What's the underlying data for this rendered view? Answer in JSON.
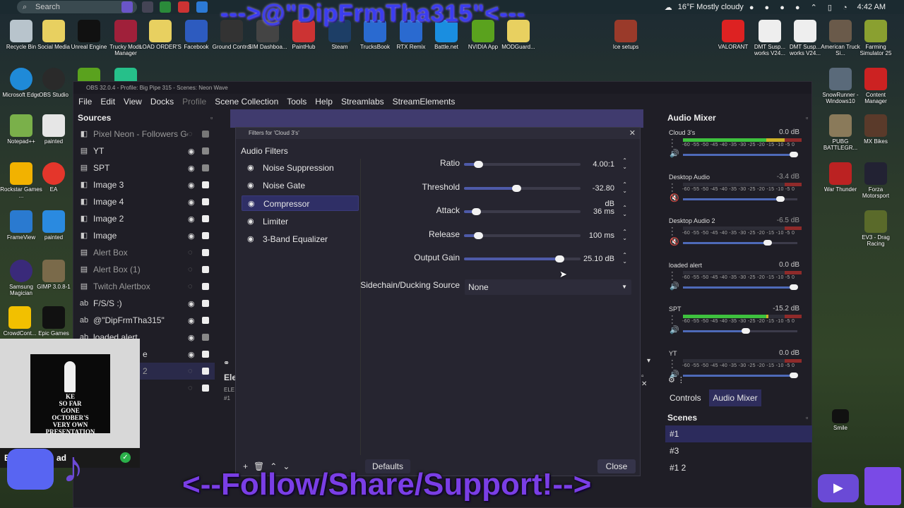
{
  "taskbar": {
    "search_placeholder": "Search",
    "weather": "16°F  Mostly cloudy",
    "time": "4:42 AM"
  },
  "banner_top": "--->@\"DipFrmTha315\"<---",
  "banner_bottom": "<--Follow/Share/Support!-->",
  "desktop_icons": {
    "recycle": "Recycle Bin",
    "social": "Social Media",
    "unreal": "Unreal Engine",
    "trucky": "Trucky Mods Manager",
    "load": "LOAD ORDER'S",
    "facebook": "Facebook",
    "ground": "Ground Control",
    "sim": "SIM Dashboa...",
    "painthub": "PaintHub",
    "steam": "Steam",
    "trucksbook": "TrucksBook",
    "rtx": "RTX Remix",
    "battle": "Battle.net",
    "nvidia": "NVIDIA App",
    "modguard": "MODGuard...",
    "ice": "Ice setups",
    "valorant": "VALORANT",
    "dmt1": "DMT Susp... works V24...",
    "dmt2": "DMT Susp... works V24...",
    "ats": "American Truck Si...",
    "farming": "Farming Simulator 25",
    "edge": "Microsoft Edge",
    "obs": "OBS Studio",
    "snowrunner": "SnowRunner - Windows10",
    "content": "Content Manager",
    "notepad": "Notepad++",
    "painted1": "painted",
    "pubg": "PUBG BATTLEGR...",
    "mxbikes": "MX Bikes",
    "rockstar": "Rockstar Games ...",
    "ea": "EA",
    "warthunder": "War Thunder",
    "forza": "Forza Motorsport",
    "frameview": "FrameView",
    "painted2": "painted",
    "ev3": "EV3 - Drag Racing",
    "samsung": "Samsung Magician",
    "gimp": "GIMP 3.0.8-1",
    "crowd": "CrowdCont...",
    "epic": "Epic Games",
    "smile": "Smile"
  },
  "obs": {
    "title": "OBS 32.0.4 - Profile: Big Pipe 315 - Scenes: Neon Wave",
    "menu": [
      "File",
      "Edit",
      "View",
      "Docks",
      "Profile",
      "Scene Collection",
      "Tools",
      "Help",
      "Streamlabs",
      "StreamElements"
    ],
    "sources_title": "Sources",
    "sources": [
      "Pixel Neon - Followers Goal",
      "YT",
      "SPT",
      "Image 3",
      "Image 4",
      "Image 2",
      "Image",
      "Alert Box",
      "Alert Box (1)",
      "Twitch  Alertbox",
      "F/S/S :)",
      "@\"DipFrmTha315\"",
      "loaded alert",
      "e",
      "2"
    ],
    "elements_label": "Ele",
    "elements_sub": "ELE",
    "elements_sub2": "#1",
    "mixer_title": "Audio Mixer",
    "mixer_scale": "-60 -55 -50 -45 -40 -35 -30 -25 -20 -15 -10 -5 0",
    "channels": [
      {
        "name": "Cloud 3's",
        "db": "0.0 dB",
        "level": 0.88,
        "volume": 1.0,
        "muted": false
      },
      {
        "name": "Desktop Audio",
        "db": "-3.4 dB",
        "level": 0.0,
        "volume": 0.88,
        "muted": true
      },
      {
        "name": "Desktop Audio 2",
        "db": "-6.5 dB",
        "level": 0.0,
        "volume": 0.77,
        "muted": true
      },
      {
        "name": "loaded alert",
        "db": "0.0 dB",
        "level": 0.0,
        "volume": 1.0,
        "muted": false
      },
      {
        "name": "SPT",
        "db": "-15.2 dB",
        "level": 0.72,
        "volume": 0.58,
        "muted": false
      },
      {
        "name": "YT",
        "db": "0.0 dB",
        "level": 0.0,
        "volume": 1.0,
        "muted": false
      }
    ],
    "tabs": [
      "Controls",
      "Audio Mixer"
    ],
    "scenes_title": "Scenes",
    "scenes": [
      "#1",
      "#3",
      "#1 2"
    ]
  },
  "filters": {
    "title": "Filters for 'Cloud 3's'",
    "section": "Audio Filters",
    "items": [
      "Noise Suppression",
      "Noise Gate",
      "Compressor",
      "Limiter",
      "3-Band Equalizer"
    ],
    "props": [
      {
        "label": "Ratio",
        "value": "4.00:1",
        "level": 0.12
      },
      {
        "label": "Threshold",
        "value": "-32.80 dB",
        "level": 0.45
      },
      {
        "label": "Attack",
        "value": "36 ms",
        "level": 0.1
      },
      {
        "label": "Release",
        "value": "100 ms",
        "level": 0.12
      },
      {
        "label": "Output Gain",
        "value": "25.10 dB",
        "level": 0.82
      }
    ],
    "sidechain_label": "Sidechain/Ducking Source",
    "sidechain_value": "None",
    "defaults": "Defaults",
    "close": "Close"
  },
  "webcam": {
    "art_text": "KE\nSO FAR\nGONE\nOCTOBER'S\nVERY OWN\nPRESENTATION",
    "name": "B",
    "name2": "ad"
  }
}
